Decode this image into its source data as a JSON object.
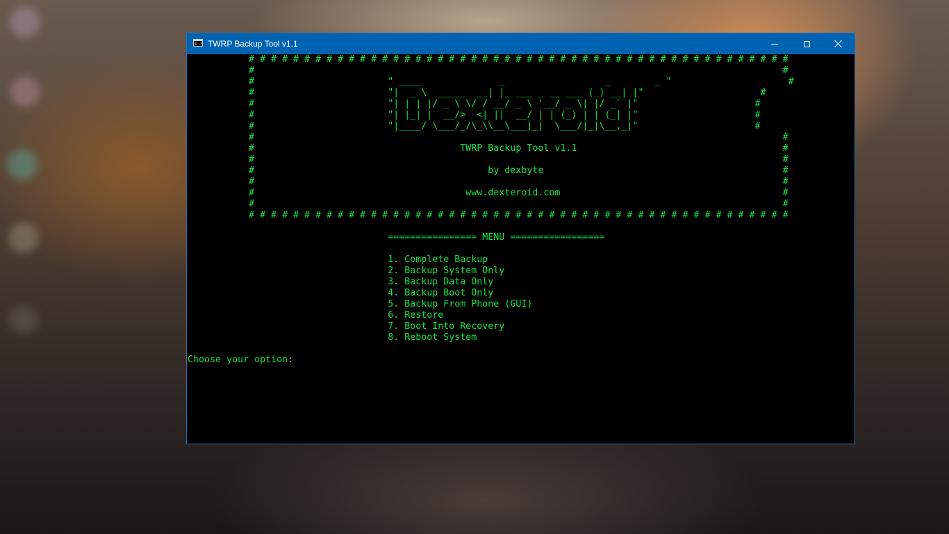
{
  "window": {
    "title": "TWRP Backup Tool v1.1",
    "icon": "console-icon",
    "accent": "#0063b1",
    "controls": [
      "minimize-icon",
      "maximize-icon",
      "close-icon"
    ]
  },
  "console": {
    "text_color": "#13e24a",
    "background": "#000000",
    "lines": [
      "           # # # # # # # # # # # # # # # # # # # # # # # # # # # # # # # # # # # # # # # # # # # # # # # # #",
      "           #                                                                                               #",
      "           #                        \" ____              _                  _        _ \"                     #",
      "           #                        \"|  _ \\  _____  __| |_ ___ _ __ ___ (_) __| |\"                     #",
      "           #                        \"| | | |/ _ \\ \\/ / __/ _ \\ '__/ _ \\| |/ _` |\"                     #",
      "           #                        \"| |_| |  __/>  <| ||  __/ | | (_) | | (_| |\"                     #",
      "           #                        \"|____/ \\___/_/\\_\\\\__\\___|_|  \\___/|_|\\__,_|\"                     #",
      "           #                                                                                               #",
      "           #                                     TWRP Backup Tool v1.1                                     #",
      "           #                                                                                               #",
      "           #                                          by dexbyte                                           #",
      "           #                                                                                               #",
      "           #                                      www.dexteroid.com                                        #",
      "           #                                                                                               #",
      "           # # # # # # # # # # # # # # # # # # # # # # # # # # # # # # # # # # # # # # # # # # # # # # # # #",
      "",
      "                                    ================ MENU =================",
      "",
      "                                    1. Complete Backup",
      "                                    2. Backup System Only",
      "                                    3. Backup Data Only",
      "                                    4. Backup Boot Only",
      "                                    5. Backup From Phone (GUI)",
      "                                    6. Restore",
      "                                    7. Boot Into Recovery",
      "                                    8. Reboot System",
      "",
      "Choose your option: "
    ]
  }
}
